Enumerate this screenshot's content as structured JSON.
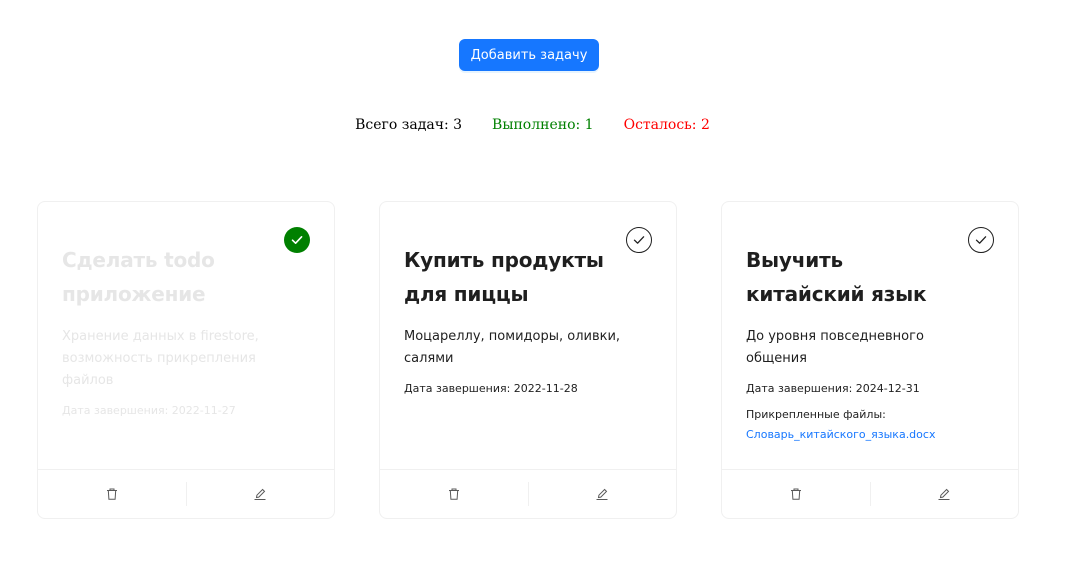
{
  "toolbar": {
    "add_label": "Добавить задачу"
  },
  "stats": {
    "total": "Всего задач: 3",
    "done": "Выполнено: 1",
    "left": "Осталось: 2"
  },
  "colors": {
    "accent": "#1677ff",
    "done": "#008000",
    "remaining": "#ff0000",
    "faded_text": "#e6e6e6"
  },
  "cards": [
    {
      "title": "Сделать todo приложение",
      "description": "Хранение данных в firestore, возможность прикрепления файлов",
      "date": "Дата завершения: 2022-11-27",
      "completed": true,
      "icons": [
        "check-circle-icon",
        "delete-icon",
        "edit-icon"
      ]
    },
    {
      "title": "Купить продукты для пиццы",
      "description": "Моцареллу, помидоры, оливки, салями",
      "date": "Дата завершения: 2022-11-28",
      "completed": false,
      "icons": [
        "check-circle-icon",
        "delete-icon",
        "edit-icon"
      ]
    },
    {
      "title": "Выучить китайский язык",
      "description": "До уровня повседневного общения",
      "date": "Дата завершения: 2024-12-31",
      "completed": false,
      "files_label": "Прикрепленные файлы:",
      "files": [
        "Словарь_китайского_языка.docx"
      ],
      "icons": [
        "check-circle-icon",
        "delete-icon",
        "edit-icon"
      ]
    }
  ]
}
